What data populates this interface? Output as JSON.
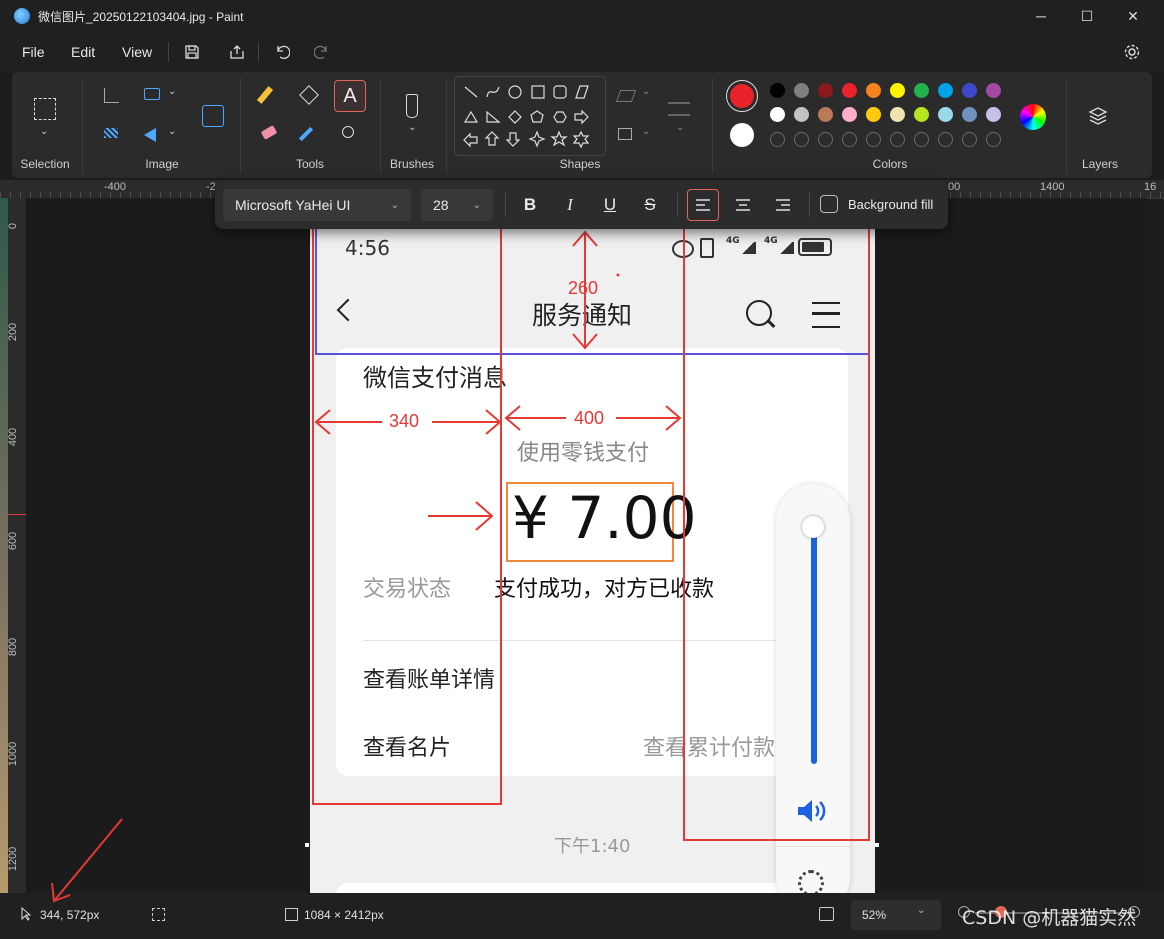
{
  "window": {
    "title": "微信图片_20250122103404.jpg - Paint",
    "minimize": "─",
    "maximize": "☐",
    "close": "✕"
  },
  "menu": {
    "file": "File",
    "edit": "Edit",
    "view": "View"
  },
  "ribbon": {
    "groups": {
      "selection": "Selection",
      "image": "Image",
      "tools": "Tools",
      "brushes": "Brushes",
      "shapes": "Shapes",
      "colors": "Colors",
      "layers": "Layers"
    },
    "text_tool_glyph": "A",
    "active_color": "#e8232a",
    "secondary_color": "#ffffff",
    "palette_row1": [
      "#000000",
      "#7f7f7f",
      "#8b1a1a",
      "#e8232a",
      "#f7831d",
      "#fff200",
      "#22b14c",
      "#00a2e8",
      "#3f48cc",
      "#a349a4"
    ],
    "palette_row2": [
      "#ffffff",
      "#c3c3c3",
      "#b97a57",
      "#ffaec9",
      "#ffc90e",
      "#efe4b0",
      "#b5e61d",
      "#99d9ea",
      "#7092be",
      "#c8bfe7"
    ]
  },
  "rulers": {
    "h_labels": [
      "-400",
      "-2",
      "00",
      "1400",
      "16"
    ],
    "v_labels": [
      "0",
      "200",
      "400",
      "600",
      "800",
      "1000",
      "1200"
    ]
  },
  "fontbar": {
    "font_name": "Microsoft YaHei UI",
    "font_size": "28",
    "bold": "B",
    "italic": "I",
    "underline": "U",
    "strike": "S",
    "background_fill": "Background fill"
  },
  "phone": {
    "time": "4:56",
    "net1": "4G",
    "net2": "4G",
    "page_title": "服务通知",
    "card_title": "微信支付消息",
    "pay_method": "使用零钱支付",
    "amount": "¥ 7.00",
    "status_label": "交易状态",
    "status_value": "支付成功，对方已收款",
    "link_bill": "查看账单详情",
    "link_card": "查看名片",
    "link_total": "查看累计付款",
    "timestamp": "下午1:40"
  },
  "annotations": {
    "height": "260",
    "left_width": "340",
    "mid_width": "400"
  },
  "status": {
    "cursor_pos": "344, 572px",
    "image_size": "1084 × 2412px",
    "zoom": "52%",
    "watermark": "CSDN @机器猫实然"
  }
}
